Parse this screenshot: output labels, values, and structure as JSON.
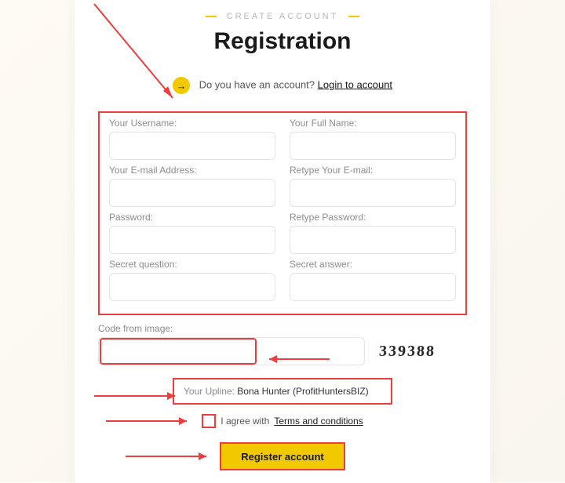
{
  "header": {
    "subtitle": "CREATE ACCOUNT",
    "title": "Registration"
  },
  "login_prompt": {
    "text": "Do you have an account?",
    "link": "Login to account"
  },
  "fields": {
    "username": {
      "label": "Your Username:"
    },
    "fullname": {
      "label": "Your Full Name:"
    },
    "email": {
      "label": "Your E-mail Address:"
    },
    "retype_email": {
      "label": "Retype Your E-mail:"
    },
    "password": {
      "label": "Password:"
    },
    "retype_password": {
      "label": "Retype Password:"
    },
    "secret_question": {
      "label": "Secret question:"
    },
    "secret_answer": {
      "label": "Secret answer:"
    }
  },
  "captcha": {
    "label": "Code from image:",
    "value": "339388"
  },
  "upline": {
    "label": "Your Upline:",
    "value": "Bona Hunter (ProfitHuntersBIZ)"
  },
  "agree": {
    "text": "I agree with",
    "link": "Terms and conditions"
  },
  "button": {
    "register": "Register account"
  }
}
